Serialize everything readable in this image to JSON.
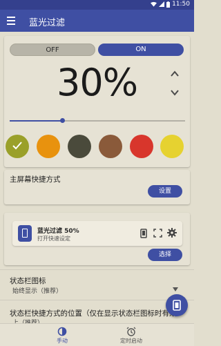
{
  "status": {
    "time": "11:50"
  },
  "appbar": {
    "title": "蓝光过滤"
  },
  "toggle": {
    "off_label": "OFF",
    "on_label": "ON",
    "state": "on"
  },
  "filter": {
    "percent_label": "30%",
    "slider_level": 0.3
  },
  "colors": {
    "accent": "#3f4fa3",
    "swatches": [
      "#9aa02a",
      "#e8920e",
      "#4a4a3b",
      "#8a5a3a",
      "#d8362c",
      "#e6d230"
    ],
    "selected_index": 0
  },
  "home_shortcut": {
    "title": "主屏幕快捷方式",
    "button": "设置"
  },
  "quick_tile": {
    "title": "蓝光过滤 50%",
    "subtitle": "打开快速设定",
    "button": "选择"
  },
  "statusbar_icon": {
    "title": "状态栏图标",
    "value": "始终显示（推荐）"
  },
  "statusbar_position": {
    "title": "状态栏快捷方式的位置（仅在显示状态栏图标时有效）",
    "value": "上（推荐）"
  },
  "bottom_nav": {
    "manual": "手动",
    "timer": "定时启动"
  }
}
